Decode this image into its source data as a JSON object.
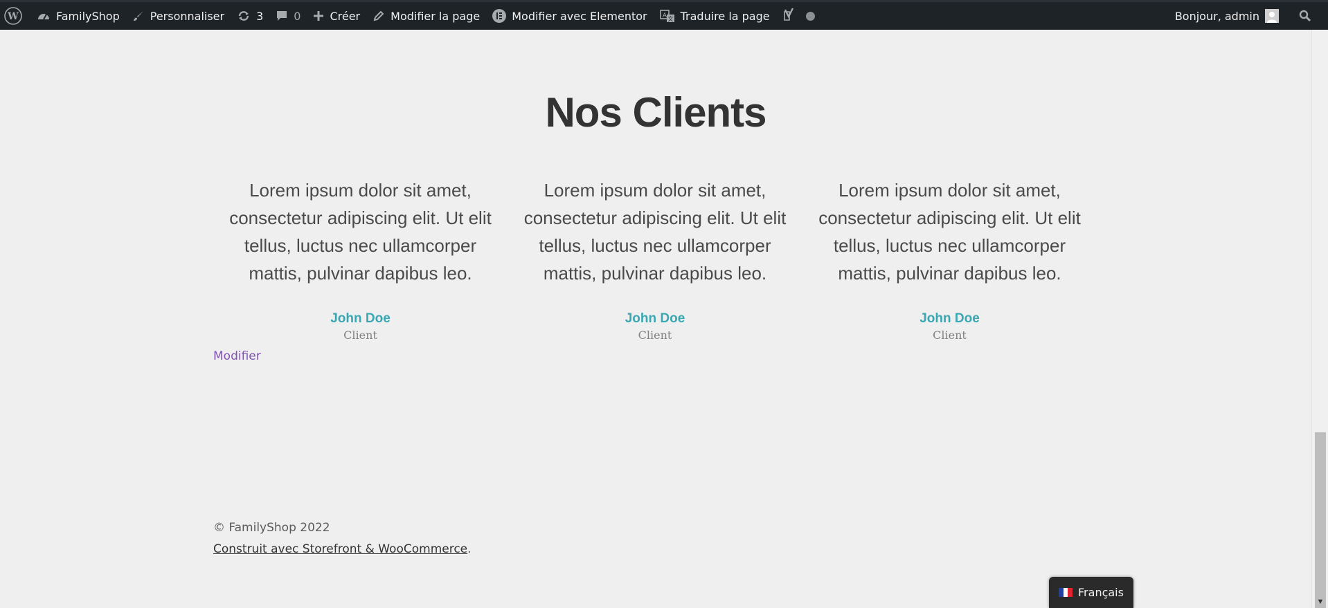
{
  "adminbar": {
    "site_name": "FamilyShop",
    "customize": "Personnaliser",
    "updates_count": "3",
    "comments_count": "0",
    "new": "Créer",
    "edit_page": "Modifier la page",
    "edit_elementor": "Modifier avec Elementor",
    "translate_page": "Traduire la page",
    "greeting": "Bonjour, admin"
  },
  "section": {
    "title": "Nos Clients"
  },
  "testimonials": [
    {
      "quote": "Lorem ipsum dolor sit amet, consectetur adipiscing elit. Ut elit tellus, luctus nec ullamcorper mattis, pulvinar dapibus leo.",
      "name": "John Doe",
      "role": "Client"
    },
    {
      "quote": "Lorem ipsum dolor sit amet, consectetur adipiscing elit. Ut elit tellus, luctus nec ullamcorper mattis, pulvinar dapibus leo.",
      "name": "John Doe",
      "role": "Client"
    },
    {
      "quote": "Lorem ipsum dolor sit amet, consectetur adipiscing elit. Ut elit tellus, luctus nec ullamcorper mattis, pulvinar dapibus leo.",
      "name": "John Doe",
      "role": "Client"
    }
  ],
  "edit_link": "Modifier",
  "footer": {
    "copyright": "© FamilyShop 2022",
    "built_with": "Construit avec Storefront & WooCommerce",
    "period": "."
  },
  "language": {
    "label": "Français"
  },
  "colors": {
    "adminbar_bg": "#1d2327",
    "accent_name": "#3aa7b3",
    "edit_link": "#7f54b3",
    "page_bg": "#efefef"
  }
}
